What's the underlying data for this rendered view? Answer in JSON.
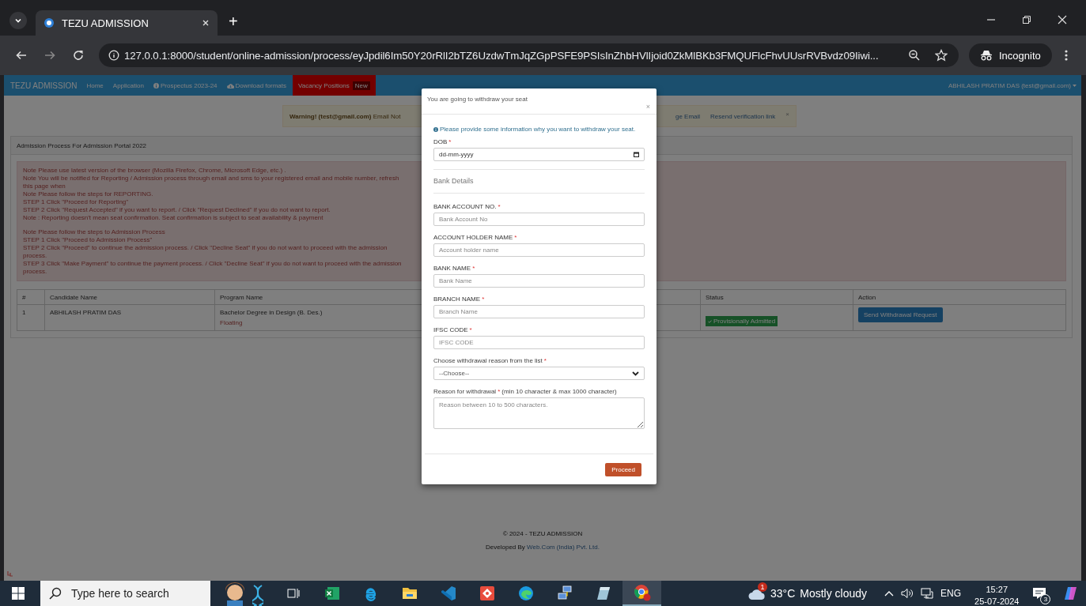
{
  "browser": {
    "tab_title": "TEZU ADMISSION",
    "new_tab": "+",
    "url": "127.0.0.1:8000/student/online-admission/process/eyJpdil6Im50Y20rRlI2bTZ6UzdwTmJqZGpPSFE9PSIsInZhbHVlIjoid0ZkMlBKb3FMQUFlcFhvUUsrRVBvdz09Iiwi...",
    "incognito": "Incognito"
  },
  "navbar": {
    "brand": "TEZU ADMISSION",
    "items": [
      {
        "label": "Home",
        "kind": "plain"
      },
      {
        "label": "Application",
        "kind": "plain"
      },
      {
        "label": "Prospectus 2023-24",
        "kind": "info"
      },
      {
        "label": "Download formats",
        "kind": "download"
      },
      {
        "label": "Vacancy Positions",
        "kind": "featured",
        "badge": "New"
      }
    ],
    "user": "ABHILASH PRATIM DAS (test@gmail.com)"
  },
  "alert": {
    "text": "**Warning! (test@gmail.com)** Email Not",
    "links": [
      "ge Email",
      "Resend verification link"
    ],
    "close": "×"
  },
  "panel": {
    "title": "Admission Process For Admission Portal 2022",
    "note_groups": [
      [
        {
          "label": "Note",
          "text": "Please use latest version of the browser (Mozilla Firefox, Chrome, Microsoft Edge, etc.) ."
        },
        {
          "label": "Note",
          "text": "You will be notified for Reporting / Admission process through email and sms to your registered email and mobile number, refresh this page when"
        },
        {
          "label": "Note",
          "text": "Please follow the steps for REPORTING."
        },
        {
          "label": "STEP 1",
          "text": "Click \"Proceed for Reporting\""
        },
        {
          "label": "STEP 2",
          "text": "Click \"Request Accepted\" if you want to report. / Click \"Request Declined\" if you do not want to report."
        },
        {
          "label": "Note :",
          "text": "Reporting doesn't mean seat confirmation. Seat confirmation is subject to seat availability & payment"
        }
      ],
      [
        {
          "label": "Note",
          "text": "Please follow the steps to Admission Process"
        },
        {
          "label": "STEP 1",
          "text": "Click \"Proceed to Admission Process\""
        },
        {
          "label": "STEP 2",
          "text": "Click \"Proceed\" to continue the admission process. / Click \"Decline Seat\" if you do not want to proceed with the admission process."
        },
        {
          "label": "STEP 3",
          "text": "Click \"Make Payment\" to continue the payment process. / Click \"Decline Seat\" if you do not want to proceed with the admission process."
        }
      ]
    ],
    "table": {
      "columns": [
        "#",
        "Candidate Name",
        "Program Name",
        "Status",
        "Action"
      ],
      "rows": [
        {
          "index": "1",
          "candidate": "ABHILASH PRATIM DAS",
          "program": "Bachelor Degree in Design (B. Des.)",
          "program_type": "Floating",
          "status": "Provisionally Admitted",
          "action": "Send Withdrawal Request"
        }
      ]
    }
  },
  "footer": {
    "copyright": "© 2024 - TEZU ADMISSION",
    "developed_by": "Developed By",
    "developer": "Web.Com (India) Pvt. Ltd."
  },
  "modal": {
    "title": "You are going to withdraw your seat",
    "close": "×",
    "info": "Please provide some information why you want to withdraw your seat.",
    "fields": [
      {
        "kind": "date",
        "label": "DOB",
        "required_mark": "*",
        "placeholder": "dd-mm-yyyy"
      },
      {
        "kind": "heading",
        "label": "Bank Details"
      },
      {
        "kind": "text",
        "label": "BANK ACCOUNT NO.",
        "required_mark": "*",
        "placeholder": "Bank Account No"
      },
      {
        "kind": "text",
        "label": "ACCOUNT HOLDER NAME",
        "required_mark": "*",
        "placeholder": "Account holder name"
      },
      {
        "kind": "text",
        "label": "BANK NAME",
        "required_mark": "*",
        "placeholder": "Bank Name"
      },
      {
        "kind": "text",
        "label": "BRANCH NAME",
        "required_mark": "*",
        "placeholder": "Branch Name"
      },
      {
        "kind": "text",
        "label": "IFSC CODE",
        "required_mark": "*",
        "placeholder": "IFSC CODE"
      },
      {
        "kind": "select",
        "label": "Choose withdrawal reason from the list",
        "required_mark": "*",
        "value": "--Choose--"
      },
      {
        "kind": "textarea",
        "label": "Reason for withdrawal",
        "required_mark": "*",
        "hint": "(min 10 character & max 1000 character)",
        "placeholder": "Reason between 10 to 500 characters."
      }
    ],
    "submit": "Proceed"
  },
  "taskbar": {
    "search_placeholder": "Type here to search",
    "weather": {
      "badge": "1",
      "temperature": "33°C",
      "condition": "Mostly cloudy"
    },
    "language": "ENG",
    "time": "15:27",
    "date": "25-07-2024",
    "notifications": "3"
  }
}
